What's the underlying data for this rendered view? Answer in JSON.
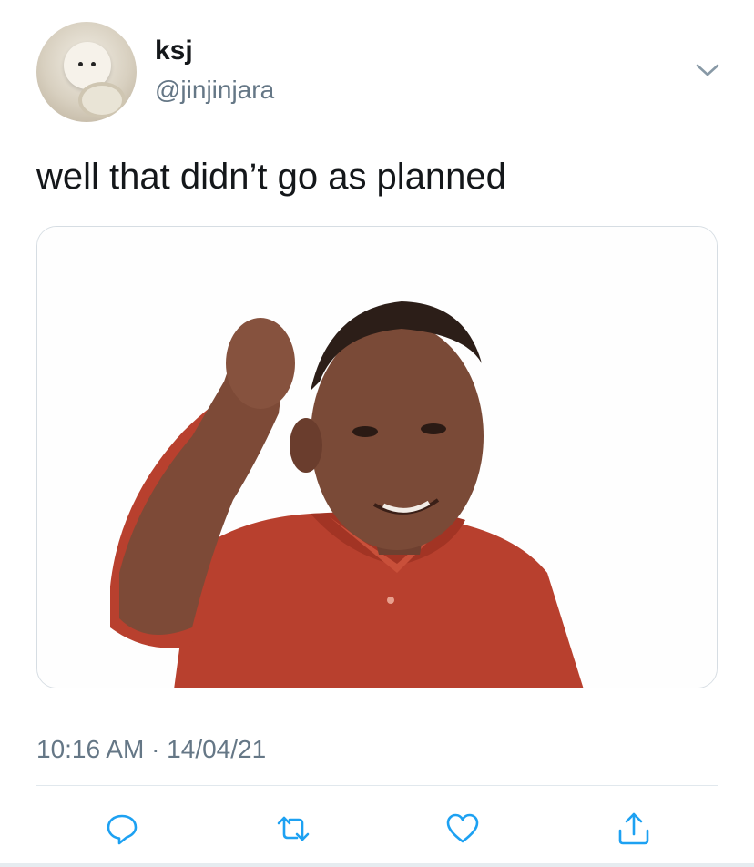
{
  "tweet": {
    "display_name": "ksj",
    "handle": "@jinjinjara",
    "text": "well that didn’t go as planned",
    "timestamp": "10:16 AM · 14/04/21",
    "media": {
      "description_icon": "photo"
    }
  },
  "icons": {
    "menu": "chevron-down-icon",
    "reply": "reply-icon",
    "retweet": "retweet-icon",
    "like": "heart-icon",
    "share": "share-icon"
  },
  "colors": {
    "text": "#14171a",
    "secondary": "#657786",
    "icon": "#1da1f2",
    "divider": "#e1e8ed"
  }
}
